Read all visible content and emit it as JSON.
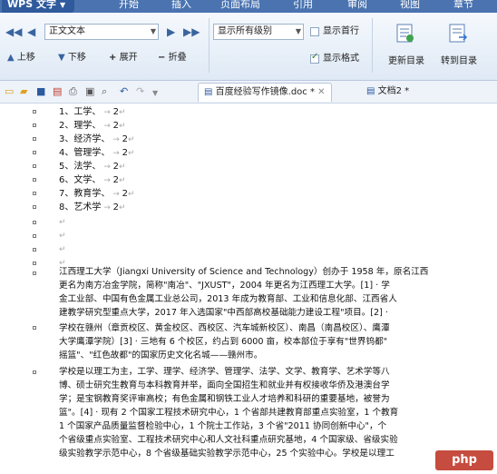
{
  "app": {
    "title": "WPS 文字"
  },
  "menu": [
    "开始",
    "插入",
    "页面布局",
    "引用",
    "审阅",
    "视图",
    "章节"
  ],
  "ribbon": {
    "style_value": "正文文本",
    "level_value": "显示所有级别",
    "show_first_line": "显示首行",
    "show_format": "显示格式",
    "promote": "上移",
    "demote": "下移",
    "expand": "展开",
    "collapse": "折叠",
    "update_toc": "更新目录",
    "goto_toc": "转到目录"
  },
  "tabs": [
    {
      "label": "百度经验写作镜像.doc *"
    },
    {
      "label": "文档2 *"
    }
  ],
  "document": {
    "list_items": [
      "1、工学、",
      "2、理学、",
      "3、经济学、",
      "4、管理学、",
      "5、法学、",
      "6、文学、",
      "7、教育学、",
      "8、艺术学"
    ],
    "page_num": "2",
    "paragraphs": [
      "江西理工大学（Jiangxi University of Science and Technology）创办于 1958 年，原名江西",
      "更名为南方冶金学院，简称\"南冶\"、\"JXUST\"，2004 年更名为江西理工大学。[1] · 学",
      "金工业部、中国有色金属工业总公司，2013 年成为教育部、工业和信息化部、江西省人",
      "建教学研究型重点大学，2017 年入选国家\"中西部高校基础能力建设工程\"项目。[2] ·",
      "学校在赣州（章贡校区、黄金校区、西校区、汽车城新校区）、南昌（南昌校区）、鹰潭",
      "大学鹰潭学院）[3] · 三地有 6 个校区，约占到 6000 亩，校本部位于享有\"世界钨都\"",
      "摇篮\"、\"红色故都\"的国家历史文化名城——赣州市。",
      "学校是以理工为主，工学、理学、经济学、管理学、法学、文学、教育学、艺术学等八",
      "博、硕士研究生教育与本科教育并举，面向全国招生和就业并有权接收华侨及港澳台学",
      "学；是宝钢教育奖评审高校；有色金属和钢铁工业人才培养和科研的重要基地，被誉为",
      "篮\"。[4] · 现有 2 个国家工程技术研究中心，1 个省部共建教育部重点实验室，1 个教育",
      "1 个国家产品质量监督检验中心，1 个院士工作站，3 个省\"2011 协同创新中心\"，个",
      "个省级重点实验室、工程技术研究中心和人文社科重点研究基地，4 个国家级、省级实验",
      "级实验教学示范中心，8 个省级基础实验教学示范中心，25 个实验中心。学校是以理工"
    ]
  },
  "watermark": "php"
}
